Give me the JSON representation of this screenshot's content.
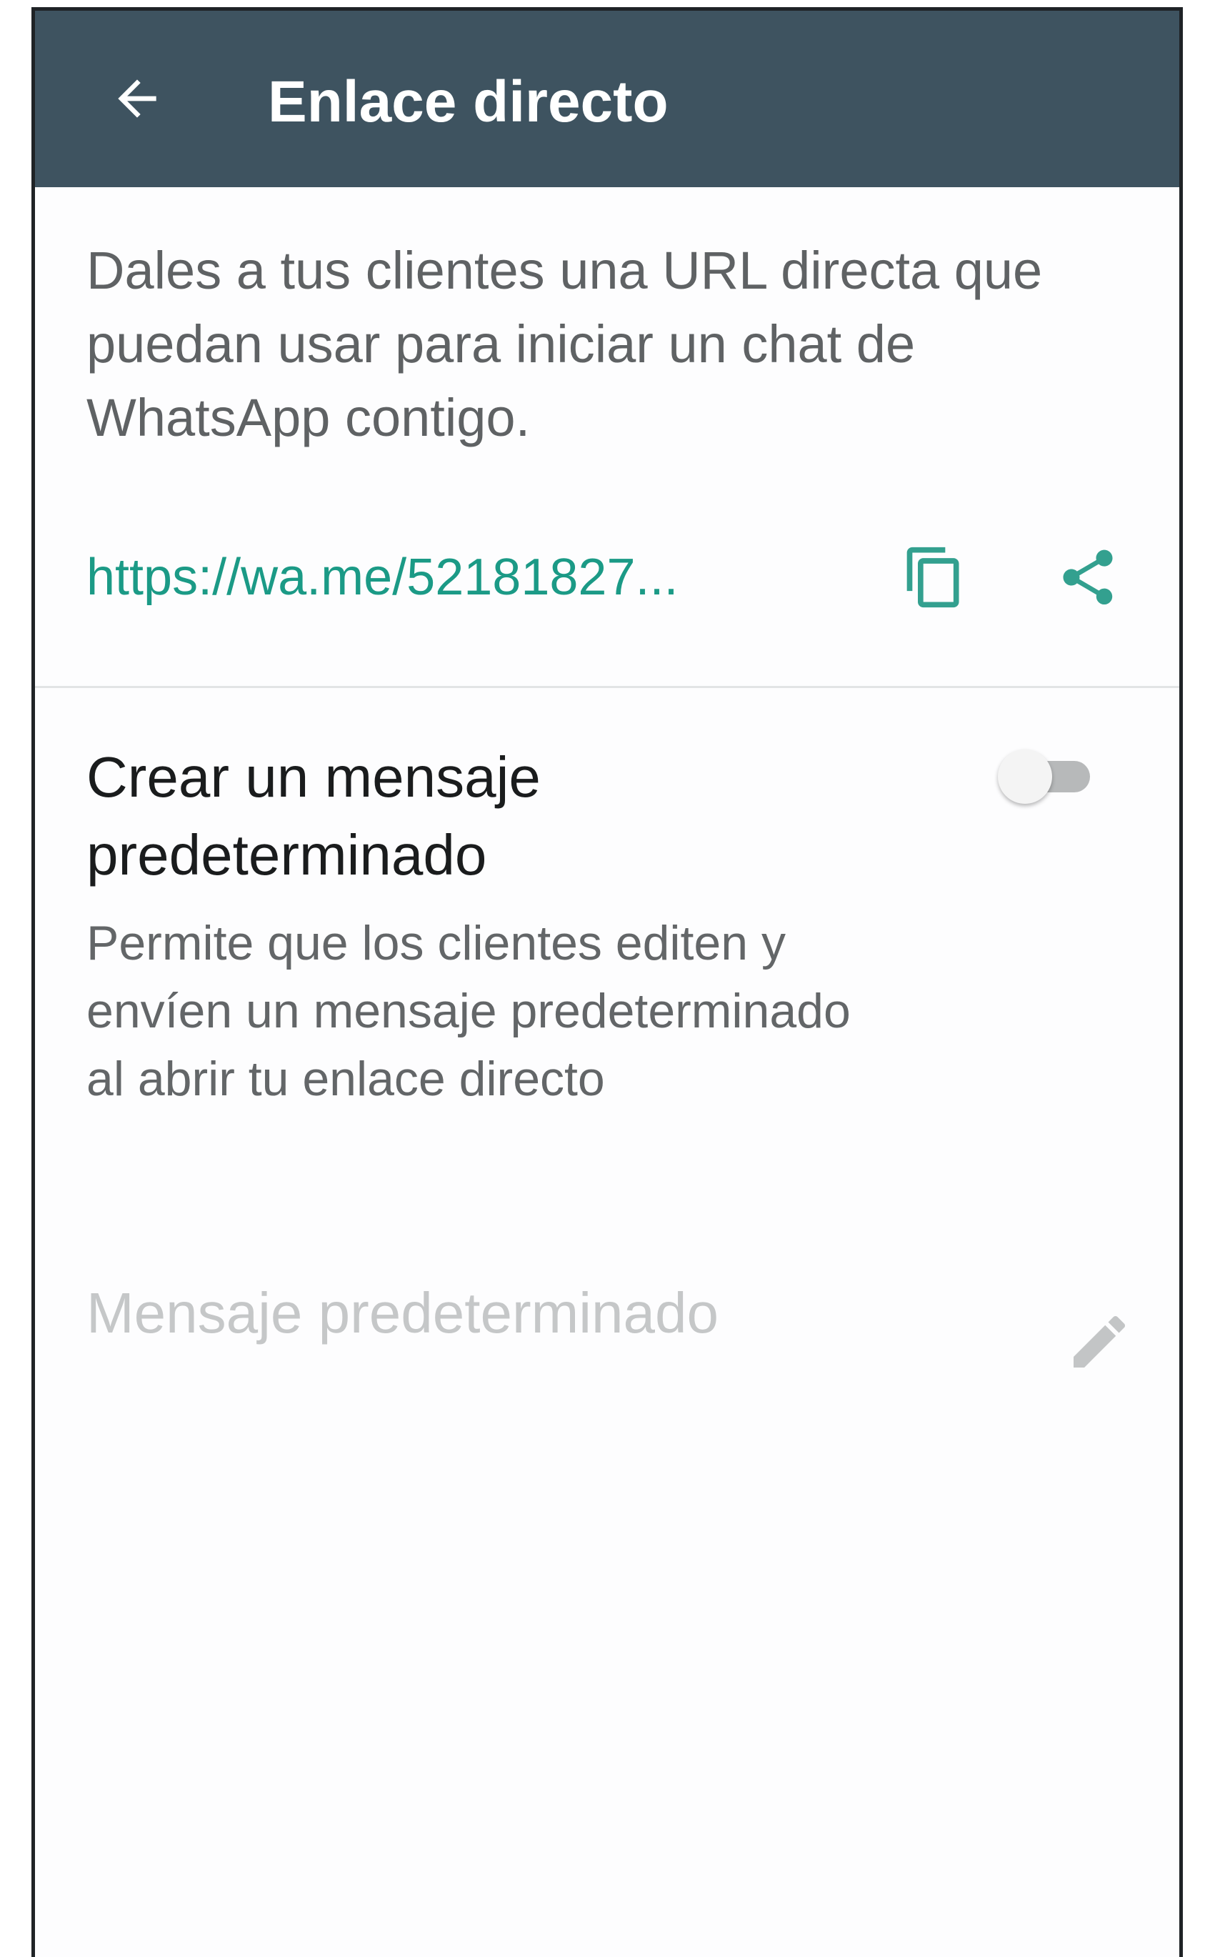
{
  "appbar": {
    "title": "Enlace directo",
    "back_icon": "arrow-back-icon",
    "background": "#3e5360"
  },
  "link_section": {
    "description": "Dales a tus clientes una URL directa que puedan usar para iniciar un chat de WhatsApp contigo.",
    "url": "https://wa.me/52181827...",
    "url_color": "#1b9a86",
    "copy_icon": "copy-icon",
    "share_icon": "share-icon"
  },
  "default_message": {
    "title": "Crear un mensaje predeterminado",
    "subtitle": "Permite que los clientes editen y envíen un mensaje predeterminado al abrir tu enlace directo",
    "toggle_on": false,
    "placeholder": "Mensaje predeterminado",
    "edit_icon": "pencil-icon"
  }
}
